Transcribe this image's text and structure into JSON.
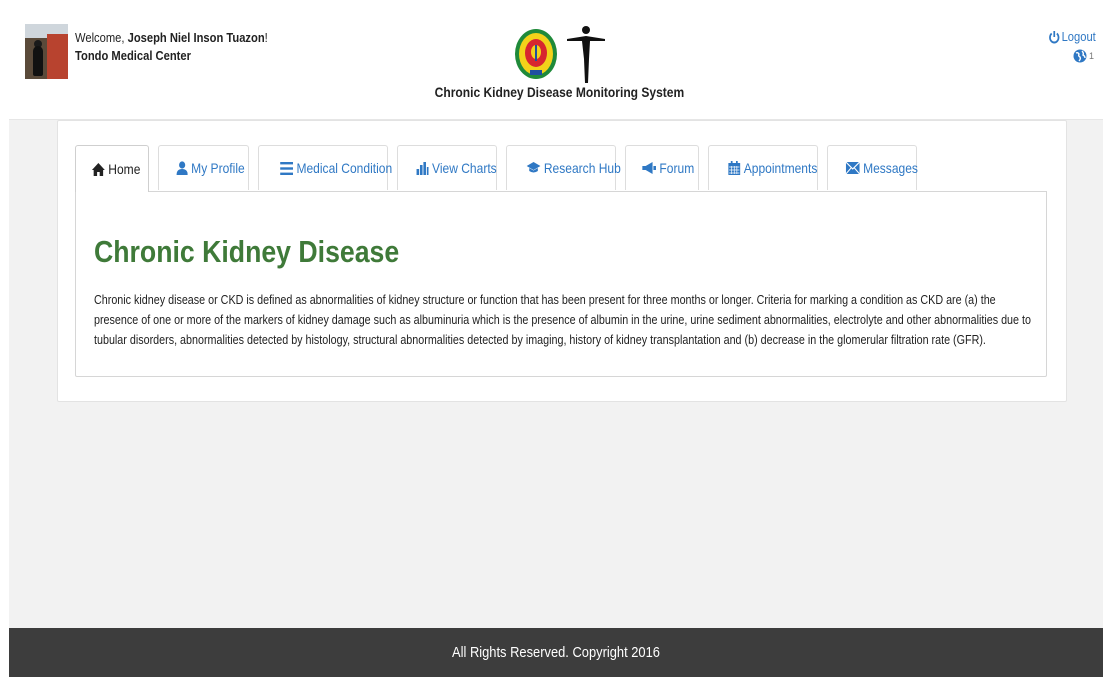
{
  "header": {
    "welcome_prefix": "Welcome, ",
    "user_name": "Joseph Niel Inson Tuazon",
    "welcome_suffix": "!",
    "hospital": "Tondo Medical Center",
    "system_title": "Chronic Kidney Disease Monitoring System",
    "logout_label": "Logout",
    "notification_count": "1"
  },
  "tabs": [
    {
      "label": "Home",
      "icon": "home-icon",
      "active": true
    },
    {
      "label": "My Profile",
      "icon": "user-icon",
      "active": false
    },
    {
      "label": "Medical Condition",
      "icon": "list-icon",
      "active": false
    },
    {
      "label": "View Charts",
      "icon": "bar-chart-icon",
      "active": false
    },
    {
      "label": "Research Hub",
      "icon": "graduation-cap-icon",
      "active": false
    },
    {
      "label": "Forum",
      "icon": "megaphone-icon",
      "active": false
    },
    {
      "label": "Appointments",
      "icon": "calendar-icon",
      "active": false
    },
    {
      "label": "Messages",
      "icon": "envelope-icon",
      "active": false
    }
  ],
  "main": {
    "heading": "Chronic Kidney Disease",
    "paragraph": "Chronic kidney disease or CKD is defined as abnormalities of kidney structure or function that has been present for three months or longer. Criteria for marking a condition as CKD are (a) the presence of one or more of the markers of kidney damage such as albuminuria which is the presence of albumin in the urine, urine sediment abnormalities, electrolyte and other abnormalities due to tubular disorders, abnormalities detected by histology, structural abnormalities detected by imaging, history of kidney transplantation and (b) decrease in the glomerular filtration rate (GFR)."
  },
  "footer": {
    "text": "All Rights Reserved. Copyright 2016"
  },
  "colors": {
    "link": "#2f78c4",
    "heading": "#3f7a39",
    "footer_bg": "#3d3d3d"
  }
}
